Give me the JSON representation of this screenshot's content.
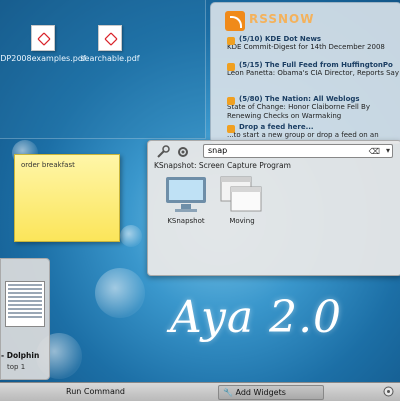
{
  "desktop": {
    "files": [
      {
        "name": "DP2008examples.pdf"
      },
      {
        "name": "searchable.pdf"
      }
    ],
    "brand_text": "Aya 2.0"
  },
  "rss": {
    "brand_main": "RSS",
    "brand_accent": "NOW",
    "feeds": [
      {
        "header": "(5/10) KDE Dot News",
        "item": "KDE Commit-Digest for 14th December 2008"
      },
      {
        "header": "(5/15) The Full Feed from HuffingtonPo",
        "item": "Leon Panetta: Obama's CIA Director, Reports Say"
      },
      {
        "header": "(5/80) The Nation: All Weblogs",
        "item": "State of Change: Honor Claiborne Fell By Renewing Checks on Warmaking"
      },
      {
        "header": "Drop a feed here...",
        "item": "...to start a new group or drop a feed on an"
      }
    ]
  },
  "note": {
    "text": "order breakfast"
  },
  "krunner": {
    "query": "snap",
    "description": "KSnapshot: Screen Capture Program",
    "results": [
      {
        "label": "KSnapshot"
      },
      {
        "label": "Moving"
      }
    ]
  },
  "dolphin": {
    "title": "- Dolphin",
    "subtitle": "top 1"
  },
  "taskbar": {
    "run_command": "Run Command",
    "add_widgets": "Add Widgets"
  },
  "colors": {
    "accent": "#f08a1a",
    "note": "#fbe55a",
    "pdf_red": "#d9232a"
  }
}
